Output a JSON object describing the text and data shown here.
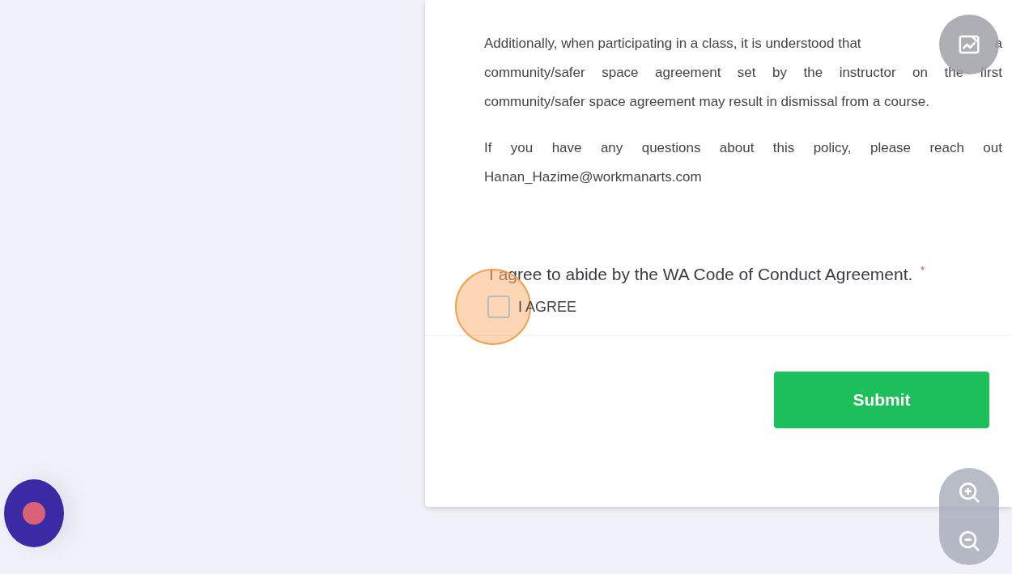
{
  "policy_paragraphs": [
    {
      "lines": [
        [
          "Additionally, when participating in a class, it is understood that",
          "a"
        ],
        [
          "community/safer space agreement set by the instructor on the first"
        ],
        [
          "community/safer space agreement may result in dismissal from a course."
        ]
      ]
    },
    {
      "lines": [
        [
          "If you have any questions about this policy, please reach out"
        ],
        [
          "Hanan_Hazime@workmanarts.com"
        ]
      ]
    }
  ],
  "agreement": {
    "question": "I agree to abide by the WA Code of Conduct Agreement.",
    "required_mark": "*",
    "option": "I AGREE",
    "checked": false,
    "click_highlight": true
  },
  "submit_button": "Submit"
}
